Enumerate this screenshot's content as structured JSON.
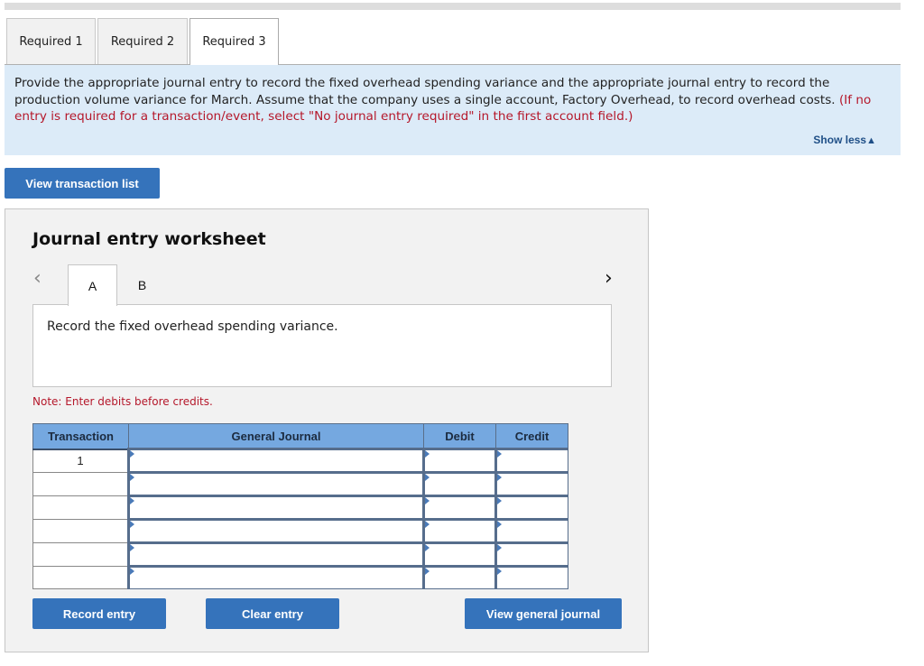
{
  "tabs": [
    {
      "label": "Required 1",
      "active": false
    },
    {
      "label": "Required 2",
      "active": false
    },
    {
      "label": "Required 3",
      "active": true
    }
  ],
  "instructions": {
    "text": "Provide the appropriate journal entry to record the fixed overhead spending variance and the appropriate journal entry to record the production volume variance for March. Assume that the company uses a single account, Factory Overhead, to record overhead costs.",
    "red_text": "(If no entry is required for a transaction/event, select \"No journal entry required\" in the first account field.)",
    "toggle_label": "Show less",
    "toggle_icon": "triangle-up-icon"
  },
  "view_transaction_list_label": "View transaction list",
  "worksheet": {
    "title": "Journal entry worksheet",
    "prev_icon": "chevron-left-icon",
    "next_icon": "chevron-right-icon",
    "entry_tabs": [
      {
        "label": "A",
        "active": true
      },
      {
        "label": "B",
        "active": false
      }
    ],
    "description": "Record the fixed overhead spending variance.",
    "note": "Note: Enter debits before credits.",
    "table": {
      "headers": [
        "Transaction",
        "General Journal",
        "Debit",
        "Credit"
      ],
      "rows": [
        {
          "transaction": "1",
          "account": "",
          "debit": "",
          "credit": ""
        },
        {
          "transaction": "",
          "account": "",
          "debit": "",
          "credit": ""
        },
        {
          "transaction": "",
          "account": "",
          "debit": "",
          "credit": ""
        },
        {
          "transaction": "",
          "account": "",
          "debit": "",
          "credit": ""
        },
        {
          "transaction": "",
          "account": "",
          "debit": "",
          "credit": ""
        },
        {
          "transaction": "",
          "account": "",
          "debit": "",
          "credit": ""
        }
      ]
    },
    "buttons": {
      "record": "Record entry",
      "clear": "Clear entry",
      "view_general_journal": "View general journal"
    }
  },
  "colors": {
    "accent_blue": "#3573bb",
    "instruction_bg": "#dcebf8",
    "alert_red": "#b5182b",
    "table_header": "#75a8e0"
  }
}
